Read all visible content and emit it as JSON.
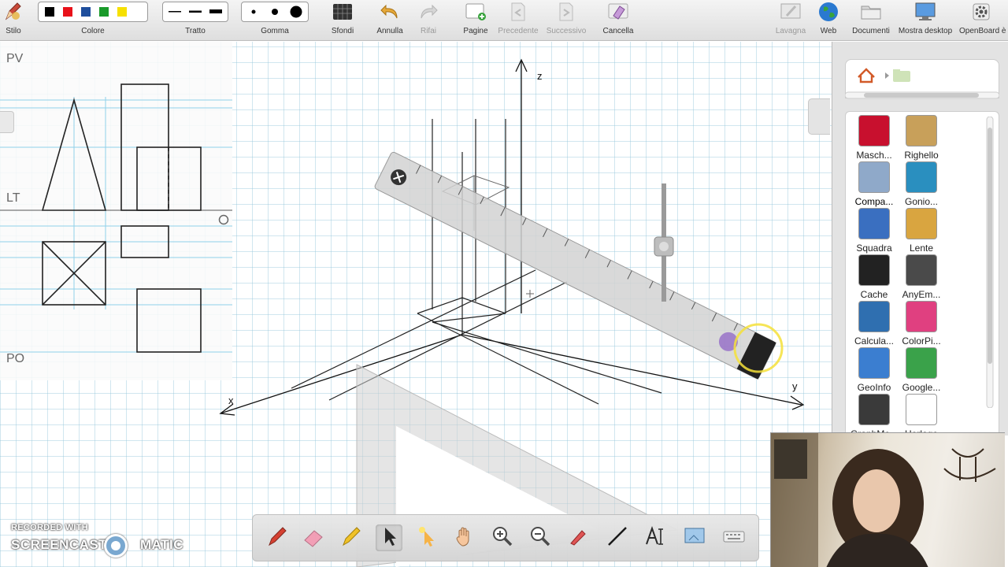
{
  "toolbar": {
    "stilo": "Stilo",
    "colore": "Colore",
    "tratto": "Tratto",
    "gomma": "Gomma",
    "sfondi": "Sfondi",
    "annulla": "Annulla",
    "rifai": "Rifai",
    "pagine": "Pagine",
    "precedente": "Precedente",
    "successivo": "Successivo",
    "cancella": "Cancella",
    "lavagna": "Lavagna",
    "web": "Web",
    "documenti": "Documenti",
    "mostra_desktop": "Mostra desktop",
    "openboard": "OpenBoard è",
    "colors": [
      "#000000",
      "#e8111a",
      "#1f4e9c",
      "#1a9a2a",
      "#f6e000"
    ]
  },
  "orthographic": {
    "pv": "PV",
    "lt": "LT",
    "po": "PO",
    "origin": "O"
  },
  "axes": {
    "z": "z",
    "x": "x",
    "y": "y"
  },
  "library": {
    "items": [
      {
        "name": "Masch...",
        "icon": "mask-icon",
        "color": "#c8102e"
      },
      {
        "name": "Righello",
        "icon": "ruler-icon",
        "color": "#c8a05a"
      },
      {
        "name": "Compa...",
        "icon": "compass-icon",
        "color": "#8fa9c9"
      },
      {
        "name": "Gonio...",
        "icon": "protractor-icon",
        "color": "#2a8fbf"
      },
      {
        "name": "Squadra",
        "icon": "triangle-ruler-icon",
        "color": "#3a6fc0"
      },
      {
        "name": "Lente",
        "icon": "magnifier-icon",
        "color": "#d9a540"
      },
      {
        "name": "Cache",
        "icon": "cache-icon",
        "color": "#222222"
      },
      {
        "name": "AnyEm...",
        "icon": "embed-icon",
        "color": "#4a4a4a"
      },
      {
        "name": "Calcula...",
        "icon": "calculator-icon",
        "color": "#2f6fb0"
      },
      {
        "name": "ColorPi...",
        "icon": "color-picker-icon",
        "color": "#e04080"
      },
      {
        "name": "GeoInfo",
        "icon": "world-map-icon",
        "color": "#3b7ed0"
      },
      {
        "name": "Google...",
        "icon": "google-maps-icon",
        "color": "#3aa24a"
      },
      {
        "name": "GraphMe...",
        "icon": "graph-icon",
        "color": "#3a3a3a"
      },
      {
        "name": "Horloge",
        "icon": "clock-icon",
        "color": "#ffffff"
      }
    ]
  },
  "watermark": {
    "recorded_with": "RECORDED WITH",
    "brand_left": "SCREENCAST",
    "brand_right": "MATIC"
  },
  "dock": {
    "tools": [
      "pen-icon",
      "eraser-icon",
      "highlighter-icon",
      "select-pointer-icon",
      "laser-pointer-icon",
      "hand-icon",
      "zoom-in-icon",
      "zoom-out-icon",
      "pointer-pen-icon",
      "line-icon",
      "text-icon",
      "capture-icon",
      "keyboard-icon"
    ]
  }
}
